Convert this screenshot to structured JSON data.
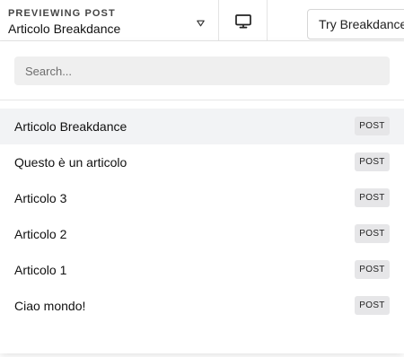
{
  "header": {
    "caption": "PREVIEWING POST",
    "selected_post": "Articolo Breakdance",
    "caret_icon": "caret-down-icon",
    "device_icon": "desktop-monitor-icon",
    "try_button_label": "Try Breakdance"
  },
  "dropdown": {
    "search_placeholder": "Search...",
    "search_value": "",
    "posts": [
      {
        "title": "Articolo Breakdance",
        "type": "POST",
        "active": true
      },
      {
        "title": "Questo è un articolo",
        "type": "POST",
        "active": false
      },
      {
        "title": "Articolo 3",
        "type": "POST",
        "active": false
      },
      {
        "title": "Articolo 2",
        "type": "POST",
        "active": false
      },
      {
        "title": "Articolo 1",
        "type": "POST",
        "active": false
      },
      {
        "title": "Ciao mondo!",
        "type": "POST",
        "active": false
      }
    ]
  },
  "colors": {
    "active_row_background": "#f2f3f5",
    "badge_background": "#e6e6e8",
    "search_background": "#efefef"
  }
}
